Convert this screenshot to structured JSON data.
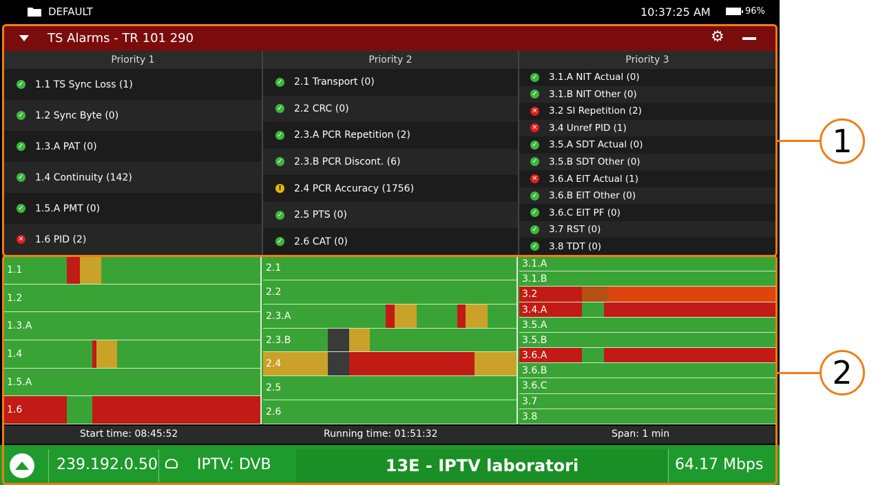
{
  "status": {
    "profile": "DEFAULT",
    "clock": "10:37:25 AM",
    "battery": "96%"
  },
  "panel": {
    "title": "TS Alarms - TR 101 290"
  },
  "priorities": [
    {
      "header": "Priority 1",
      "items": [
        {
          "label": "1.1 TS Sync Loss (1)",
          "status": "ok"
        },
        {
          "label": "1.2 Sync Byte (0)",
          "status": "ok"
        },
        {
          "label": "1.3.A PAT (0)",
          "status": "ok"
        },
        {
          "label": "1.4 Continuity (142)",
          "status": "ok"
        },
        {
          "label": "1.5.A PMT (0)",
          "status": "ok"
        },
        {
          "label": "1.6 PID (2)",
          "status": "err"
        }
      ]
    },
    {
      "header": "Priority 2",
      "items": [
        {
          "label": "2.1 Transport (0)",
          "status": "ok"
        },
        {
          "label": "2.2 CRC (0)",
          "status": "ok"
        },
        {
          "label": "2.3.A PCR Repetition (2)",
          "status": "ok"
        },
        {
          "label": "2.3.B PCR Discont. (6)",
          "status": "ok"
        },
        {
          "label": "2.4 PCR Accuracy (1756)",
          "status": "warn"
        },
        {
          "label": "2.5 PTS (0)",
          "status": "ok"
        },
        {
          "label": "2.6 CAT (0)",
          "status": "ok"
        }
      ]
    },
    {
      "header": "Priority 3",
      "items": [
        {
          "label": "3.1.A NIT Actual (0)",
          "status": "ok"
        },
        {
          "label": "3.1.B NIT Other (0)",
          "status": "ok"
        },
        {
          "label": "3.2 SI Repetition (2)",
          "status": "err"
        },
        {
          "label": "3.4 Unref PID (1)",
          "status": "err"
        },
        {
          "label": "3.5.A SDT Actual (0)",
          "status": "ok"
        },
        {
          "label": "3.5.B SDT Other (0)",
          "status": "ok"
        },
        {
          "label": "3.6.A EIT Actual (1)",
          "status": "err"
        },
        {
          "label": "3.6.B EIT Other (0)",
          "status": "ok"
        },
        {
          "label": "3.6.C EIT PF (0)",
          "status": "ok"
        },
        {
          "label": "3.7 RST (0)",
          "status": "ok"
        },
        {
          "label": "3.8 TDT (0)",
          "status": "ok"
        }
      ]
    }
  ],
  "timeline": {
    "colors": {
      "ok": "#3aa335",
      "red": "#c21a14",
      "yellow": "#c9a227",
      "gray": "#3a3a3a",
      "orange": "#e0440e",
      "brick": "#b55014"
    },
    "columns": [
      {
        "rows": [
          {
            "label": "1.1",
            "segs": [
              [
                0.245,
                0.295,
                "red"
              ],
              [
                0.295,
                0.38,
                "yellow"
              ]
            ]
          },
          {
            "label": "1.2",
            "segs": []
          },
          {
            "label": "1.3.A",
            "segs": []
          },
          {
            "label": "1.4",
            "segs": [
              [
                0.345,
                0.36,
                "red"
              ],
              [
                0.36,
                0.44,
                "yellow"
              ]
            ]
          },
          {
            "label": "1.5.A",
            "segs": []
          },
          {
            "label": "1.6",
            "segs": [
              [
                0,
                0.245,
                "red"
              ],
              [
                0.345,
                1,
                "red"
              ]
            ]
          }
        ]
      },
      {
        "rows": [
          {
            "label": "2.1",
            "segs": []
          },
          {
            "label": "2.2",
            "segs": []
          },
          {
            "label": "2.3.A",
            "segs": [
              [
                0.485,
                0.52,
                "red"
              ],
              [
                0.52,
                0.605,
                "yellow"
              ],
              [
                0.765,
                0.8,
                "red"
              ],
              [
                0.8,
                0.885,
                "yellow"
              ]
            ]
          },
          {
            "label": "2.3.B",
            "segs": [
              [
                0.255,
                0.34,
                "gray"
              ],
              [
                0.34,
                0.42,
                "yellow"
              ]
            ]
          },
          {
            "label": "2.4",
            "segs": [
              [
                0,
                0.255,
                "yellow"
              ],
              [
                0.255,
                0.34,
                "gray"
              ],
              [
                0.34,
                0.835,
                "red"
              ],
              [
                0.835,
                1,
                "yellow"
              ]
            ]
          },
          {
            "label": "2.5",
            "segs": []
          },
          {
            "label": "2.6",
            "segs": []
          }
        ]
      },
      {
        "rows": [
          {
            "label": "3.1.A",
            "segs": []
          },
          {
            "label": "3.1.B",
            "segs": []
          },
          {
            "label": "3.2",
            "segs": [
              [
                0,
                0.245,
                "red"
              ],
              [
                0.245,
                0.35,
                "brick"
              ],
              [
                0.35,
                1,
                "orange"
              ]
            ]
          },
          {
            "label": "3.4.A",
            "segs": [
              [
                0,
                0.245,
                "red"
              ],
              [
                0.33,
                1,
                "red"
              ]
            ]
          },
          {
            "label": "3.5.A",
            "segs": []
          },
          {
            "label": "3.5.B",
            "segs": []
          },
          {
            "label": "3.6.A",
            "segs": [
              [
                0,
                0.245,
                "red"
              ],
              [
                0.33,
                1,
                "red"
              ]
            ]
          },
          {
            "label": "3.6.B",
            "segs": []
          },
          {
            "label": "3.6.C",
            "segs": []
          },
          {
            "label": "3.7",
            "segs": []
          },
          {
            "label": "3.8",
            "segs": []
          }
        ]
      }
    ]
  },
  "info": {
    "start": "Start time: 08:45:52",
    "running": "Running time: 01:51:32",
    "span": "Span: 1 min"
  },
  "bottom": {
    "ip": "239.192.0.50",
    "service_type": "IPTV: DVB",
    "channel": "13E - IPTV laboratori",
    "bitrate": "64.17 Mbps"
  },
  "callouts": [
    "1",
    "2"
  ]
}
